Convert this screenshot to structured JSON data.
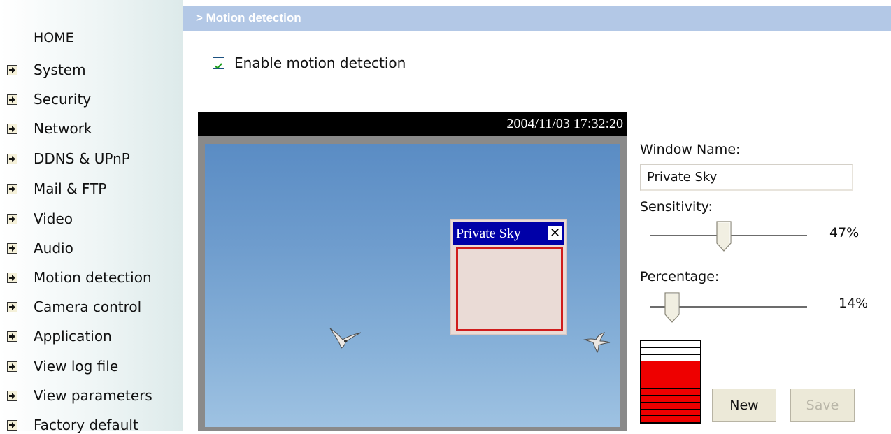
{
  "header": {
    "title": "> Motion detection"
  },
  "sidebar": {
    "home": "HOME",
    "items": [
      {
        "label": "System"
      },
      {
        "label": "Security"
      },
      {
        "label": "Network"
      },
      {
        "label": "DDNS & UPnP"
      },
      {
        "label": "Mail & FTP"
      },
      {
        "label": "Video"
      },
      {
        "label": "Audio"
      },
      {
        "label": "Motion detection"
      },
      {
        "label": "Camera control"
      },
      {
        "label": "Application"
      },
      {
        "label": "View log file"
      },
      {
        "label": "View parameters"
      },
      {
        "label": "Factory default"
      }
    ],
    "item_icon": "arrow-right-icon"
  },
  "enable": {
    "label": "Enable motion detection",
    "checked": true
  },
  "video": {
    "timestamp": "2004/11/03 17:32:20",
    "window": {
      "title": "Private Sky",
      "close_icon": "close-icon"
    }
  },
  "panel": {
    "window_name_label": "Window Name:",
    "window_name_value": "Private Sky",
    "sensitivity_label": "Sensitivity:",
    "sensitivity_value": "47%",
    "sensitivity_level": 0.47,
    "percentage_label": "Percentage:",
    "percentage_value": "14%",
    "percentage_level": 0.14,
    "activity_level": 0.75,
    "activity_color": "#ee0000"
  },
  "buttons": {
    "new": "New",
    "save": "Save"
  },
  "colors": {
    "header_bg": "#b3c8e6",
    "window_title_bg": "#0000a8",
    "window_border": "#d01c1c"
  }
}
